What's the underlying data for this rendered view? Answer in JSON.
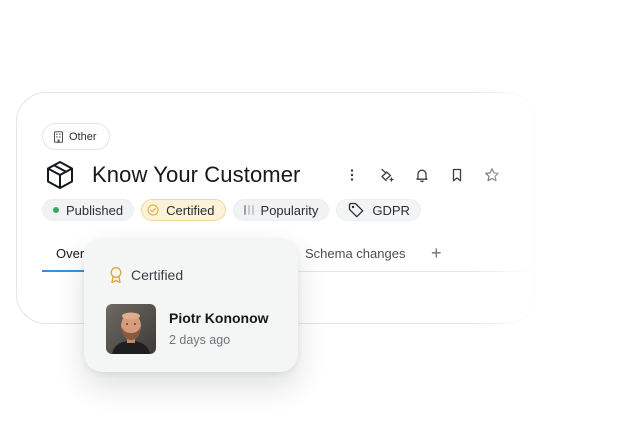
{
  "category_chip": {
    "label": "Other",
    "icon": "building-icon"
  },
  "asset": {
    "title": "Know Your Customer",
    "icon": "cube-icon"
  },
  "actions": [
    {
      "name": "more-options-button",
      "icon": "vertical-dots-icon"
    },
    {
      "name": "lineage-button",
      "icon": "lineage-icon"
    },
    {
      "name": "notifications-button",
      "icon": "bell-icon"
    },
    {
      "name": "bookmark-button",
      "icon": "bookmark-icon"
    },
    {
      "name": "favorite-button",
      "icon": "star-icon"
    }
  ],
  "tags": {
    "published": "Published",
    "certified": "Certified",
    "popularity": "Popularity",
    "popularity_level": 0.33,
    "gdpr": "GDPR"
  },
  "tabs": {
    "overview": "Over",
    "schema_changes": "Schema changes",
    "add": "+"
  },
  "certified_popover": {
    "heading": "Certified",
    "person_name": "Piotr Kononow",
    "time_ago": "2 days ago"
  },
  "colors": {
    "published_dot": "#3aa76d",
    "certified_bg": "#fdf1d8",
    "certified_accent": "#e0a83a",
    "tab_underline": "#3b8fd6"
  }
}
